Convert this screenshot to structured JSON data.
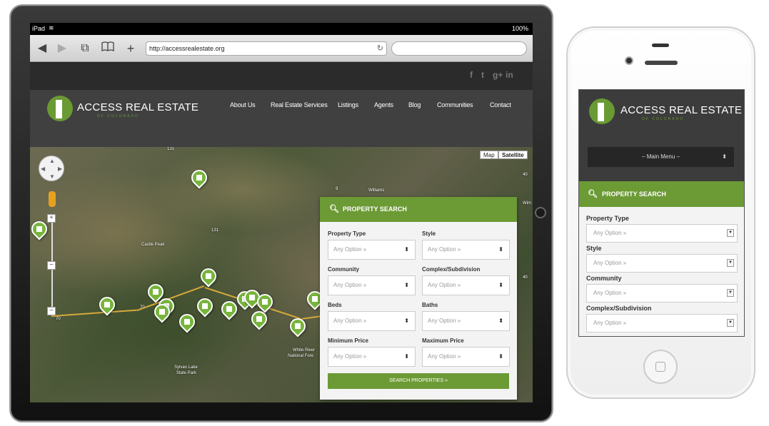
{
  "ipad": {
    "status": {
      "carrier": "iPad",
      "battery": "100%"
    },
    "browser": {
      "url": "http://accessrealestate.org",
      "back_icon": "◀",
      "forward_icon": "▶",
      "tabs_icon": "⧉",
      "bookmarks_icon": "📖",
      "add_icon": "+",
      "reload_icon": "↻"
    },
    "social": {
      "facebook": "f",
      "twitter": "t",
      "googleplus": "g+",
      "linkedin": "in"
    },
    "site": {
      "logo_title": "ACCESS REAL ESTATE",
      "logo_sub": "OF COLORADO",
      "nav": [
        "About Us",
        "Real Estate Services",
        "Listings",
        "Agents",
        "Blog",
        "Communities",
        "Contact"
      ]
    },
    "map": {
      "type_map": "Map",
      "type_satellite": "Satellite",
      "labels": [
        "Castle Peak",
        "Williams",
        "Sylvan Lake",
        "State Park",
        "White River",
        "National Fore",
        "131",
        "131",
        "70",
        "70",
        "9",
        "40",
        "40",
        "Wim"
      ]
    },
    "search": {
      "title": "PROPERTY SEARCH",
      "fields": [
        {
          "label": "Property Type",
          "value": "Any Option »"
        },
        {
          "label": "Style",
          "value": "Any Option »"
        },
        {
          "label": "Community",
          "value": "Any Option »"
        },
        {
          "label": "Complex/Subdivision",
          "value": "Any Option »"
        },
        {
          "label": "Beds",
          "value": "Any Option »"
        },
        {
          "label": "Baths",
          "value": "Any Option »"
        },
        {
          "label": "Minimum Price",
          "value": "Any Option »"
        },
        {
          "label": "Maximum Price",
          "value": "Any Option »"
        }
      ],
      "button": "SEARCH PROPERTIES »"
    }
  },
  "iphone": {
    "logo_title": "ACCESS REAL ESTATE",
    "logo_sub": "OF COLORADO",
    "menu": "– Main Menu –",
    "search_title": "PROPERTY SEARCH",
    "fields": [
      {
        "label": "Property Type",
        "value": "Any Option »"
      },
      {
        "label": "Style",
        "value": "Any Option »"
      },
      {
        "label": "Community",
        "value": "Any Option »"
      },
      {
        "label": "Complex/Subdivision",
        "value": "Any Option »"
      }
    ]
  },
  "colors": {
    "brand_green": "#6c9a35",
    "header_dark": "#404040",
    "marker_green": "#78b43c"
  }
}
